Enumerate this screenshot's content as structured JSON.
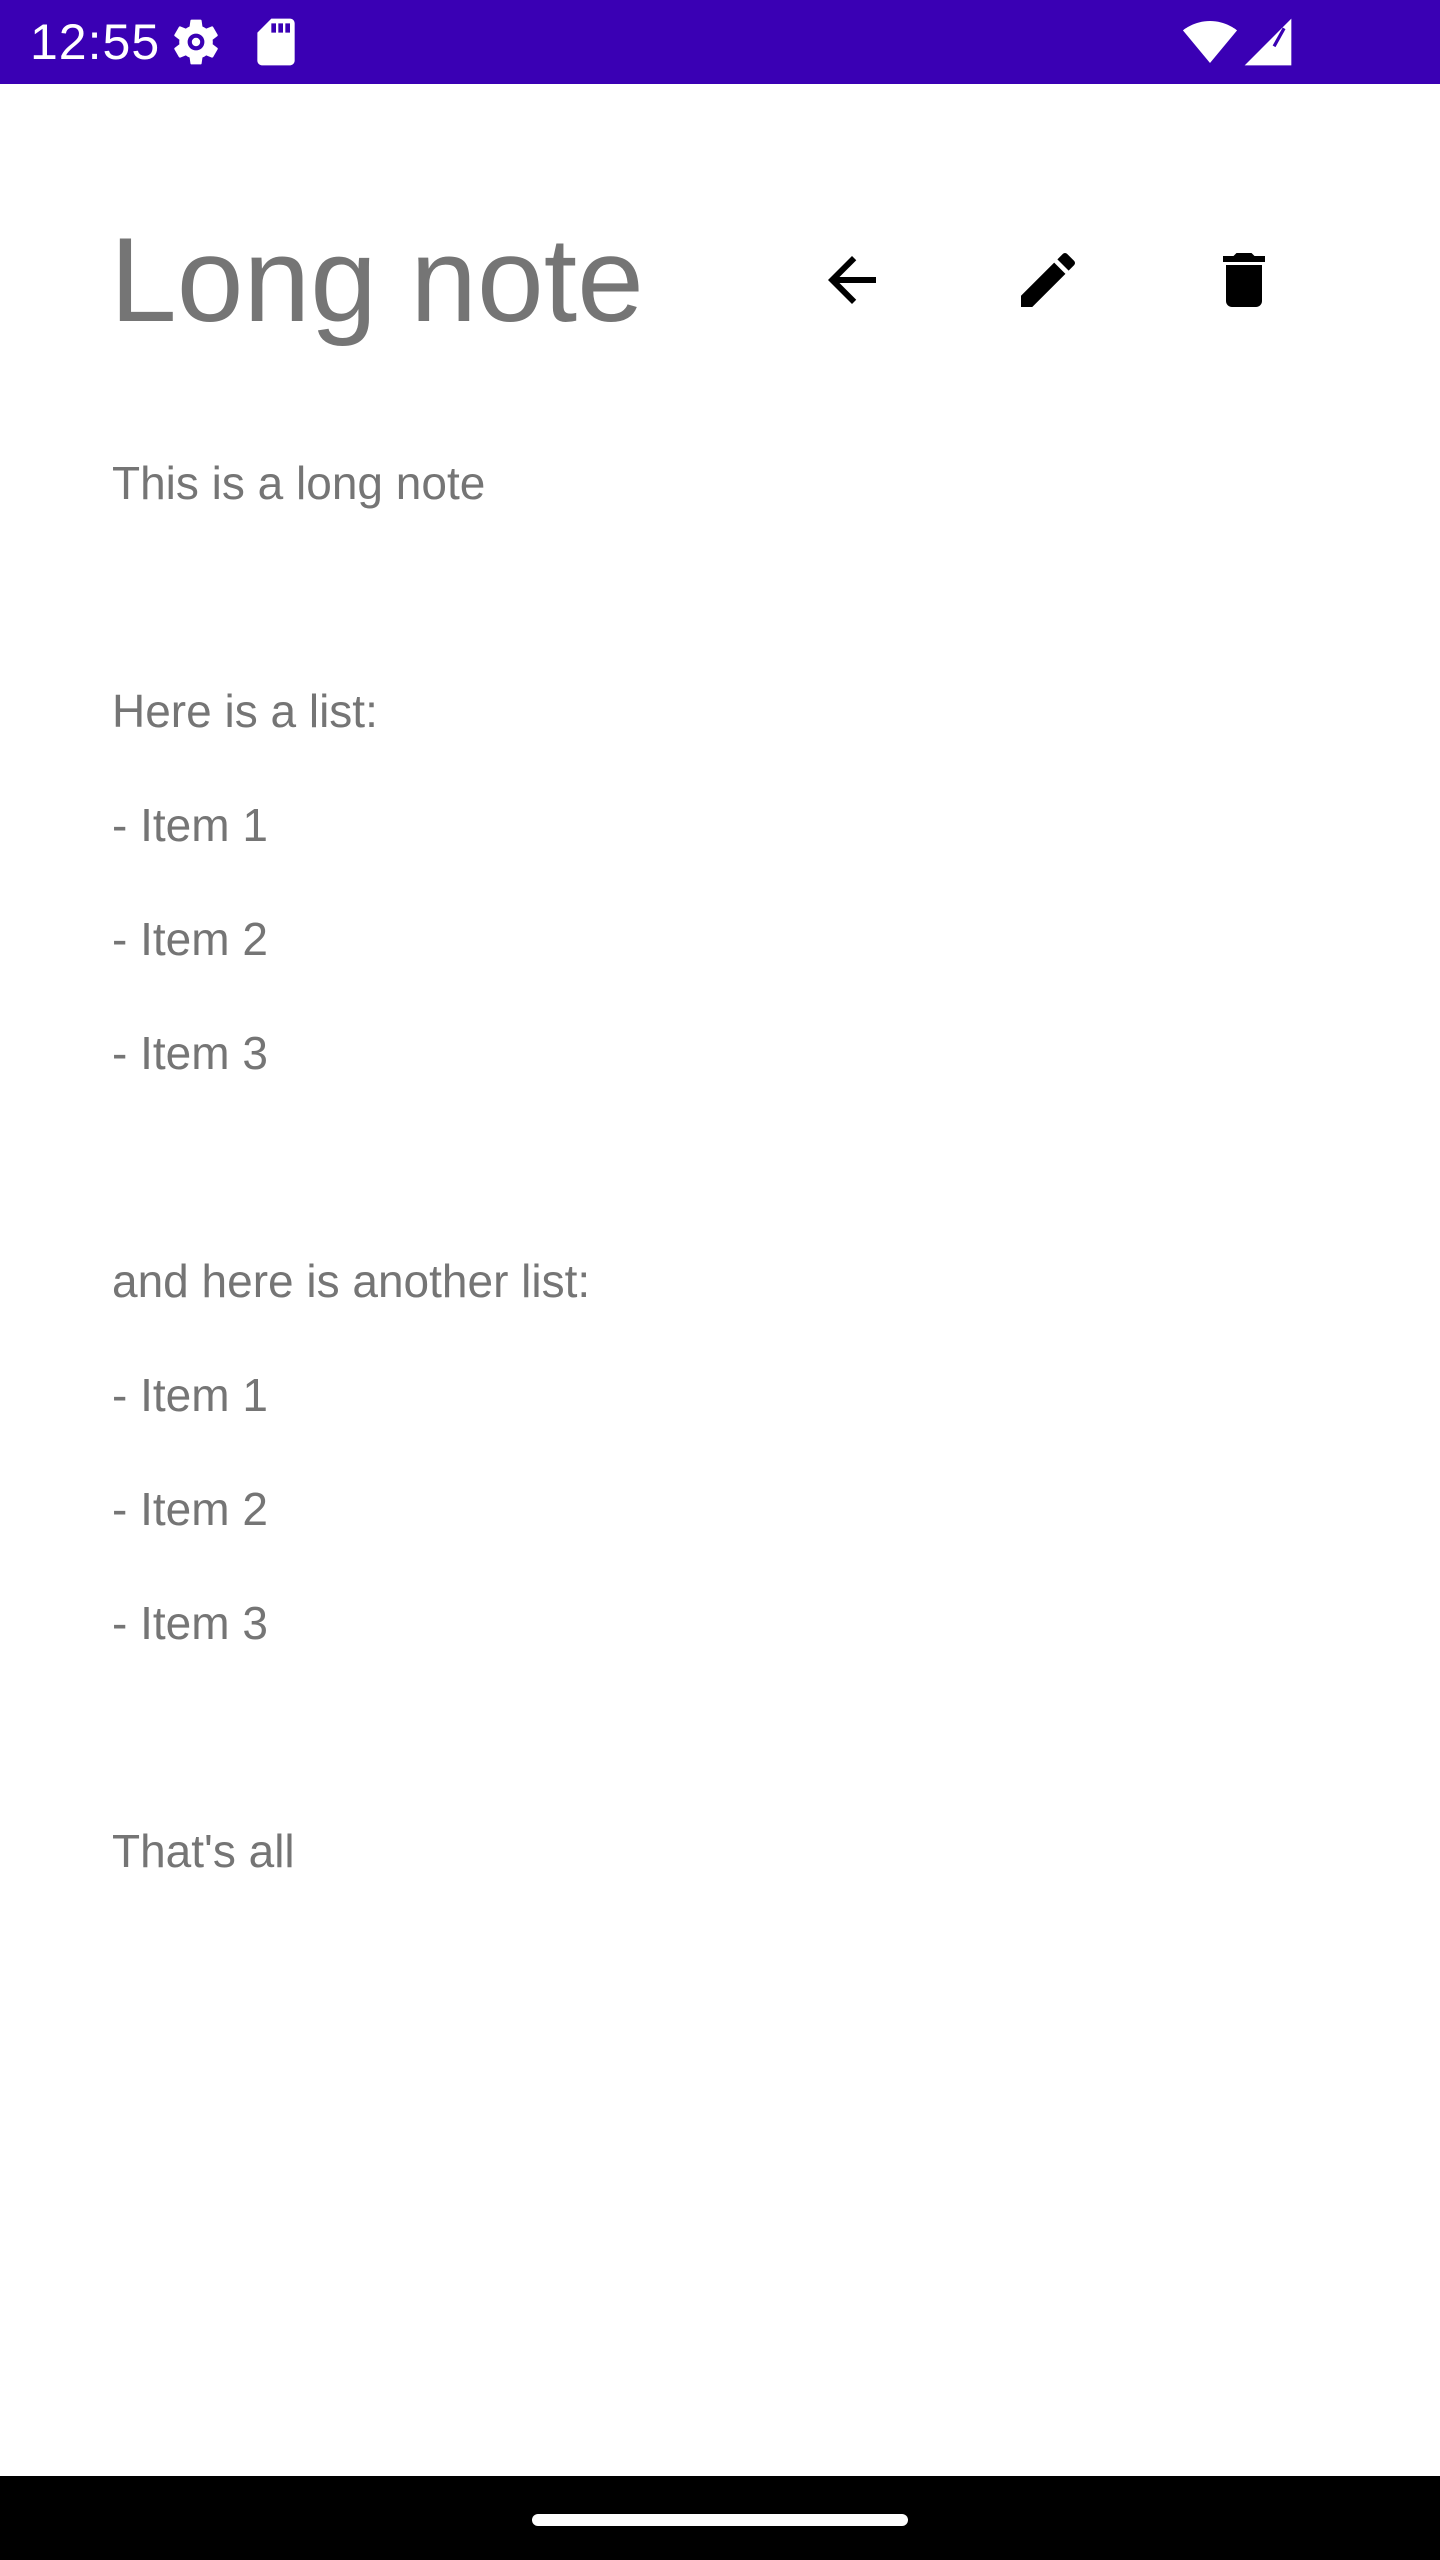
{
  "status_bar": {
    "time": "12:55",
    "background_color": "#3a00b4",
    "icons": [
      "gear-icon",
      "sd-card-icon",
      "wifi-icon",
      "signal-icon"
    ]
  },
  "note": {
    "title": "Long note",
    "lines": [
      "This is a long note",
      "",
      "Here is a list:",
      "- Item 1",
      "- Item 2",
      "- Item 3",
      "",
      "and here is another list:",
      "- Item 1",
      "- Item 2",
      "- Item 3",
      "",
      "That's all"
    ]
  },
  "actions": {
    "back_icon": "arrow-back-icon",
    "edit_icon": "pencil-icon",
    "delete_icon": "trash-icon"
  },
  "colors": {
    "text": "#757575",
    "icon": "#000000",
    "nav_bar": "#000000"
  }
}
